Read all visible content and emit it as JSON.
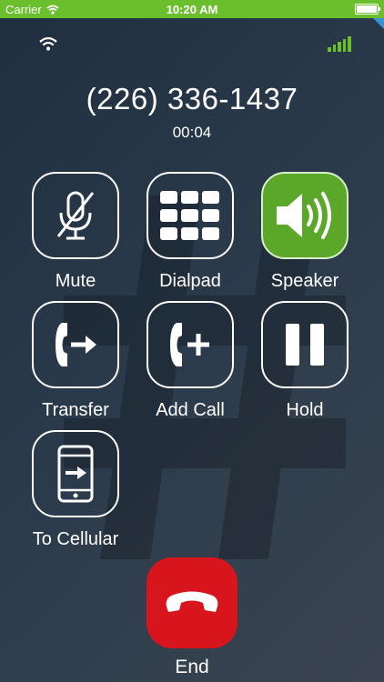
{
  "status_bar": {
    "carrier": "Carrier",
    "time": "10:20 AM"
  },
  "call": {
    "number": "(226) 336-1437",
    "duration": "00:04"
  },
  "buttons": {
    "mute": {
      "label": "Mute",
      "icon": "mic-off-icon"
    },
    "dialpad": {
      "label": "Dialpad",
      "icon": "dialpad-icon"
    },
    "speaker": {
      "label": "Speaker",
      "icon": "speaker-icon",
      "active": true
    },
    "transfer": {
      "label": "Transfer",
      "icon": "transfer-icon"
    },
    "add_call": {
      "label": "Add Call",
      "icon": "add-call-icon"
    },
    "hold": {
      "label": "Hold",
      "icon": "pause-icon"
    },
    "to_cellular": {
      "label": "To Cellular",
      "icon": "phone-transfer-icon"
    },
    "end": {
      "label": "End",
      "icon": "hang-up-icon"
    }
  },
  "colors": {
    "accent": "#6cbf2c",
    "end": "#d8141d",
    "corner": "#3b90d8"
  }
}
